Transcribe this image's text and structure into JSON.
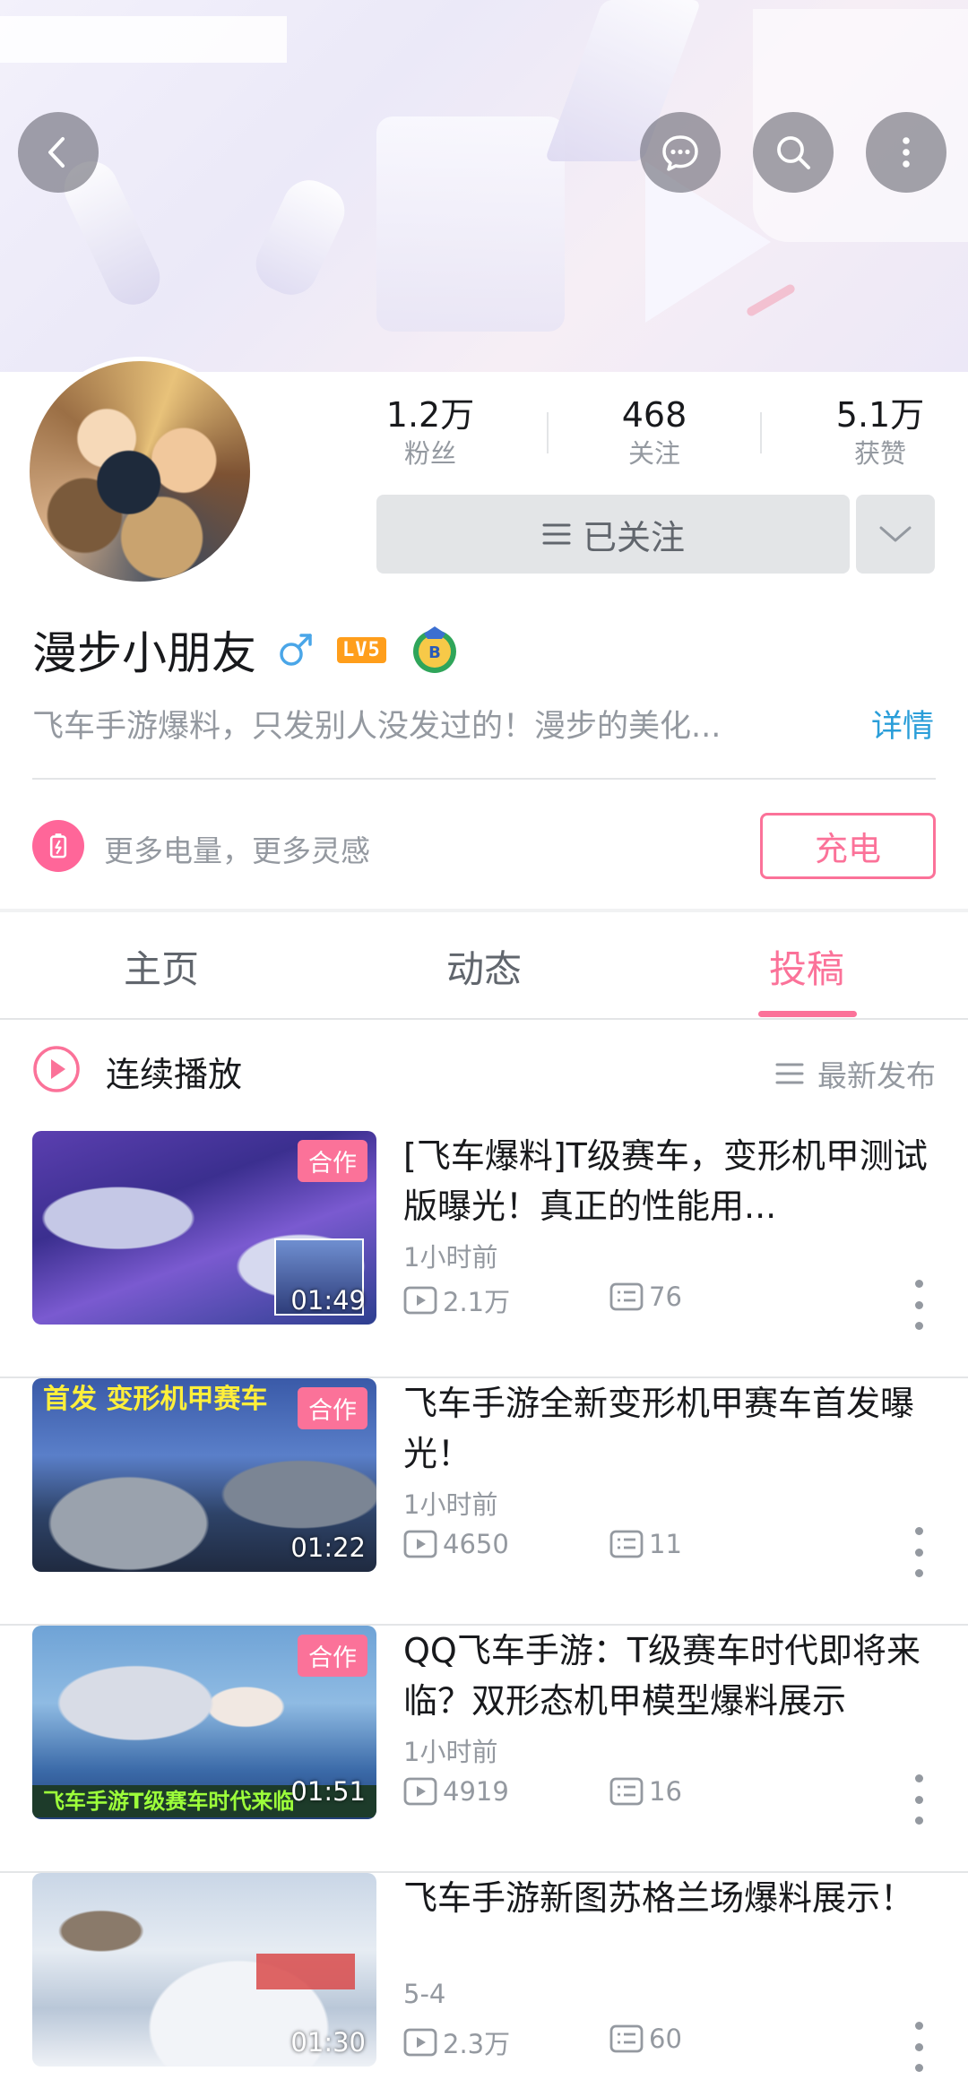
{
  "header": {
    "back_icon": "back-arrow-icon",
    "message_icon": "message-bubble-icon",
    "search_icon": "search-icon",
    "more_icon": "more-vertical-icon"
  },
  "profile": {
    "name": "漫步小朋友",
    "level": "LV5",
    "bio": "飞车手游爆料，只发别人没发过的！漫步的美化...",
    "detail_label": "详情",
    "stats": [
      {
        "value": "1.2万",
        "label": "粉丝"
      },
      {
        "value": "468",
        "label": "关注"
      },
      {
        "value": "5.1万",
        "label": "获赞"
      }
    ],
    "follow_label": "已关注"
  },
  "charge": {
    "text": "更多电量，更多灵感",
    "button": "充电"
  },
  "tabs": [
    {
      "label": "主页",
      "active": false
    },
    {
      "label": "动态",
      "active": false
    },
    {
      "label": "投稿",
      "active": true
    }
  ],
  "playlist": {
    "label": "连续播放",
    "sort_label": "最新发布"
  },
  "videos": [
    {
      "title": "[飞车爆料]T级赛车，变形机甲测试版曝光！真正的性能用...",
      "time": "1小时前",
      "views": "2.1万",
      "danmaku": "76",
      "duration": "01:49",
      "badge": "合作"
    },
    {
      "title": "飞车手游全新变形机甲赛车首发曝光！",
      "time": "1小时前",
      "views": "4650",
      "danmaku": "11",
      "duration": "01:22",
      "badge": "合作",
      "thumb_text": "首发 变形机甲赛车"
    },
    {
      "title": "QQ飞车手游：T级赛车时代即将来临？双形态机甲模型爆料展示",
      "time": "1小时前",
      "views": "4919",
      "danmaku": "16",
      "duration": "01:51",
      "badge": "合作",
      "thumb_text": "飞车手游T级赛车时代来临"
    },
    {
      "title": "飞车手游新图苏格兰场爆料展示！",
      "time": "5-4",
      "views": "2.3万",
      "danmaku": "60",
      "duration": "01:30"
    }
  ],
  "colors": {
    "accent_pink": "#fb7299",
    "link_blue": "#2a9ed9",
    "level_orange": "#ff9e1b",
    "gender_blue": "#4aa6e8"
  }
}
